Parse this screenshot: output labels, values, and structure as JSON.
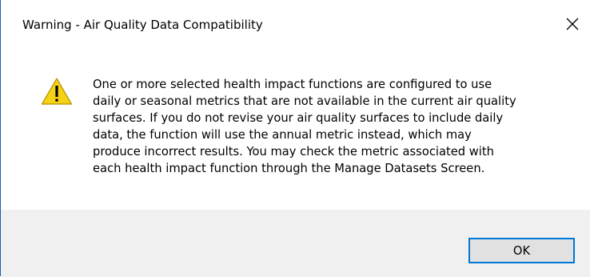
{
  "dialog": {
    "title": "Warning - Air Quality Data Compatibility",
    "close_icon": "close-icon",
    "warning_icon": "warning-triangle-icon",
    "message_lines": [
      "One or more selected health impact functions are configured to use",
      "daily or seasonal metrics that are not available in the current air quality",
      "surfaces. If you do not revise your air quality surfaces to include daily",
      "data, the function will use the annual metric instead, which may",
      "produce incorrect results.  You may check the metric associated with",
      "each health impact function through the Manage Datasets Screen."
    ],
    "ok_label": "OK"
  },
  "colors": {
    "accent": "#0078d7",
    "warning_fill": "#f5d214",
    "footer_bg": "#f0f0f0"
  }
}
